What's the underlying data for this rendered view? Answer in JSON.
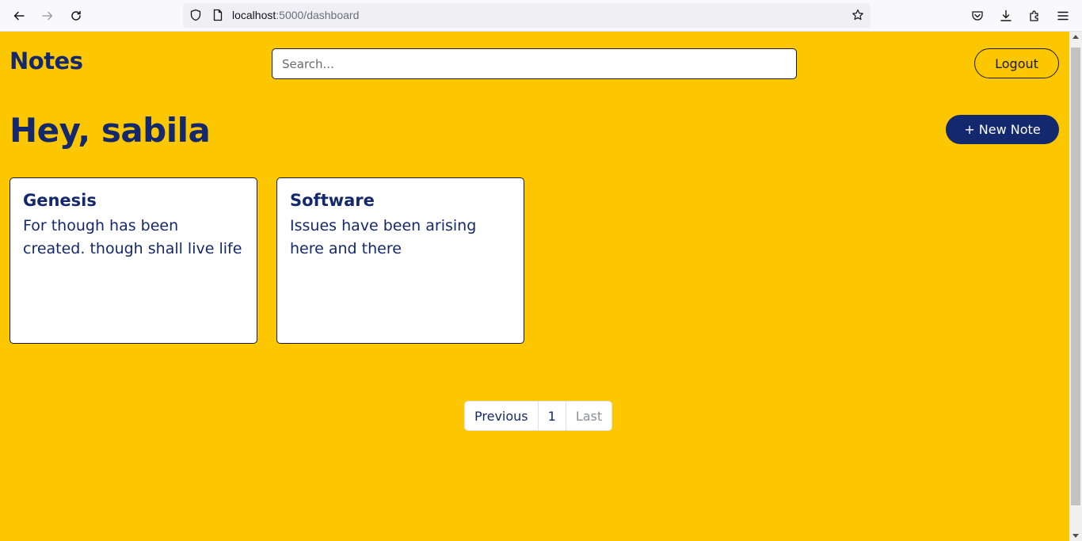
{
  "browser": {
    "url_host": "localhost",
    "url_rest": ":5000/dashboard"
  },
  "header": {
    "brand": "Notes",
    "search_placeholder": "Search...",
    "logout_label": "Logout"
  },
  "main": {
    "greeting": "Hey, sabila",
    "new_note_label": "+ New Note",
    "notes": [
      {
        "title": "Genesis",
        "body": "For though has been created. though shall live life"
      },
      {
        "title": "Software",
        "body": "Issues have been arising here and there"
      }
    ]
  },
  "pagination": {
    "previous": "Previous",
    "page": "1",
    "last": "Last"
  },
  "colors": {
    "background": "#fdc700",
    "accent": "#14286e"
  }
}
